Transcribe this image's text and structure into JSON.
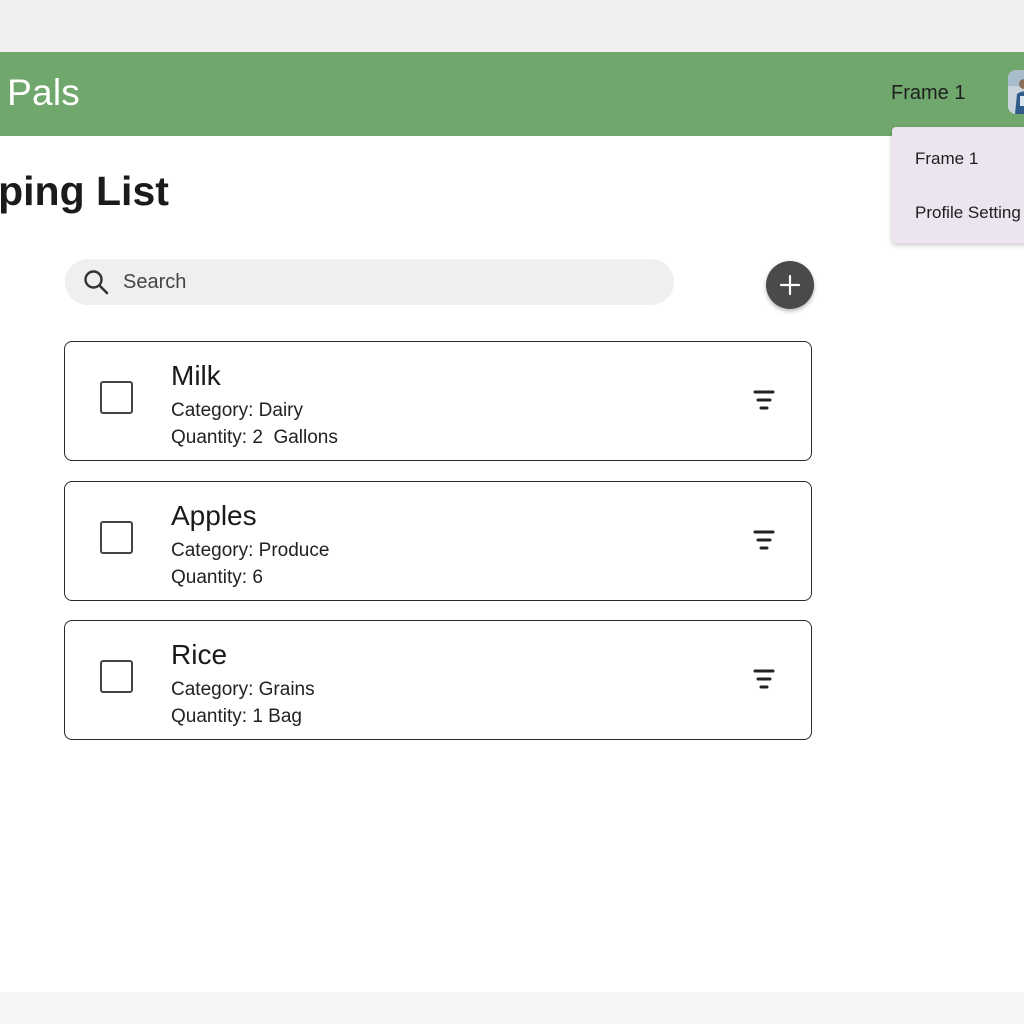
{
  "header": {
    "app_title": "y Pals",
    "frame_label": "Frame 1",
    "avatar_icon": "user-avatar-photo",
    "background_color": "#70a76c"
  },
  "profile_menu": {
    "items": [
      {
        "label": "Frame 1"
      },
      {
        "label": "Profile Setting"
      }
    ],
    "background_color": "#ece4ee"
  },
  "page": {
    "title": "opping List"
  },
  "search": {
    "placeholder": "Search",
    "value": "",
    "icon": "search-icon"
  },
  "add_button": {
    "icon": "plus-icon",
    "color": "#4a4a4a"
  },
  "items": [
    {
      "name": "Milk",
      "category": "Category: Dairy",
      "quantity": "Quantity: 2  Gallons",
      "checked": false,
      "icon": "filter-icon"
    },
    {
      "name": "Apples",
      "category": "Category: Produce",
      "quantity": "Quantity: 6",
      "checked": false,
      "icon": "filter-icon"
    },
    {
      "name": "Rice",
      "category": "Category: Grains",
      "quantity": "Quantity: 1 Bag",
      "checked": false,
      "icon": "filter-icon"
    }
  ]
}
